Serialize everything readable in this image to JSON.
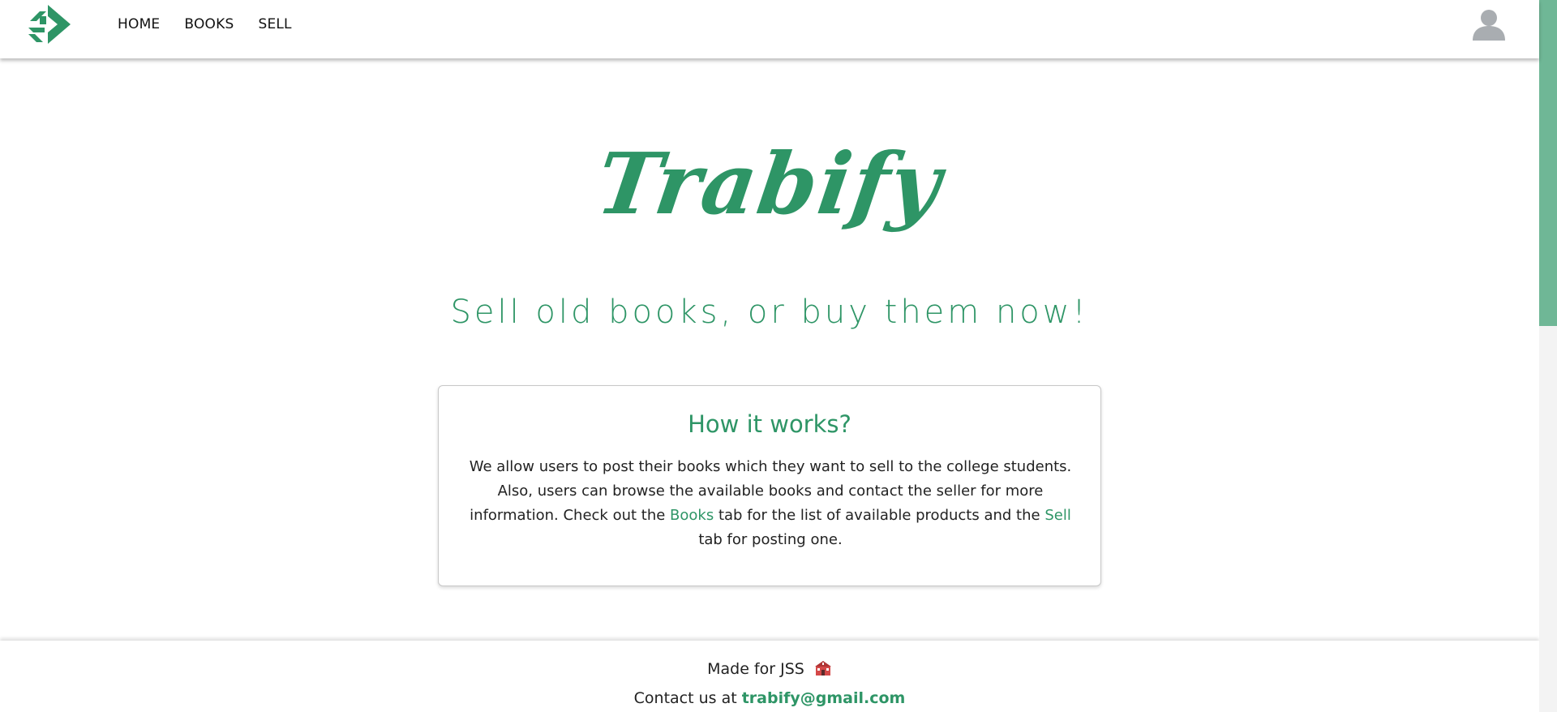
{
  "nav": {
    "logo_icon": "trabify-logo-icon",
    "links": [
      "HOME",
      "BOOKS",
      "SELL"
    ],
    "avatar_icon": "user-avatar-icon"
  },
  "hero": {
    "brand": "Trabify",
    "tagline": "Sell old books, or buy them now!"
  },
  "card": {
    "title": "How it works?",
    "body_part1": "We allow users to post their books which they want to sell to the college students. Also, users can browse the available books and contact the seller for more information. Check out the ",
    "books_link": "Books",
    "body_part2": " tab for the list of available products and the ",
    "sell_link": "Sell",
    "body_part3": " tab for posting one."
  },
  "footer": {
    "made_for": "Made for JSS",
    "school_icon": "school-icon",
    "contact_prefix": "Contact us at ",
    "email": "trabify@gmail.com"
  },
  "colors": {
    "accent": "#2e9566",
    "scrollbar": "#6fb796"
  }
}
